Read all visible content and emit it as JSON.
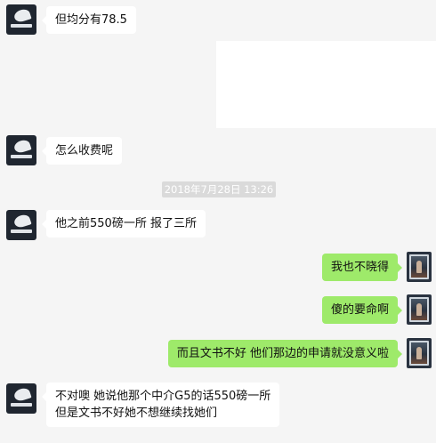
{
  "timestamp": "2018年7月28日 13:26",
  "messages": [
    {
      "side": "left",
      "text": "但均分有78.5"
    },
    {
      "side": "left",
      "text": "怎么收费呢"
    },
    {
      "side": "left",
      "text": "他之前550磅一所 报了三所"
    },
    {
      "side": "right",
      "text": "我也不晓得"
    },
    {
      "side": "right",
      "text": "傻的要命啊"
    },
    {
      "side": "right",
      "text": "而且文书不好 他们那边的申请就没意义啦"
    },
    {
      "side": "left",
      "lines": [
        "不对噢 她说他那个中介G5的话550磅一所",
        "但是文书不好她不想继续找她们"
      ]
    }
  ]
}
